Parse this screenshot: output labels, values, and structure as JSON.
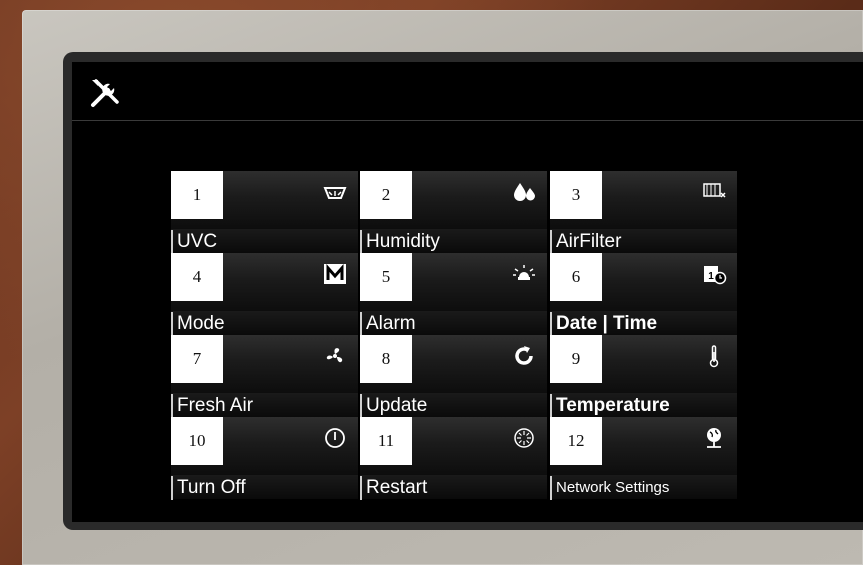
{
  "header": {
    "settings_icon": "tools-icon"
  },
  "tiles": [
    {
      "number": "1",
      "label": "UVC",
      "icon": "uvc-lamp-icon"
    },
    {
      "number": "2",
      "label": "Humidity",
      "icon": "water-drops-icon"
    },
    {
      "number": "3",
      "label": "AirFilter",
      "icon": "air-filter-icon"
    },
    {
      "number": "4",
      "label": "Mode",
      "icon": "mode-m-icon"
    },
    {
      "number": "5",
      "label": "Alarm",
      "icon": "alarm-light-icon"
    },
    {
      "number": "6",
      "label": "Date | Time",
      "icon": "calendar-clock-icon"
    },
    {
      "number": "7",
      "label": "Fresh Air",
      "icon": "fan-icon"
    },
    {
      "number": "8",
      "label": "Update",
      "icon": "update-arrow-icon"
    },
    {
      "number": "9",
      "label": "Temperature",
      "icon": "thermometer-icon"
    },
    {
      "number": "10",
      "label": "Turn Off",
      "icon": "power-icon"
    },
    {
      "number": "11",
      "label": "Restart",
      "icon": "restart-icon"
    },
    {
      "number": "12",
      "label": "Network Settings",
      "icon": "globe-network-icon"
    }
  ]
}
